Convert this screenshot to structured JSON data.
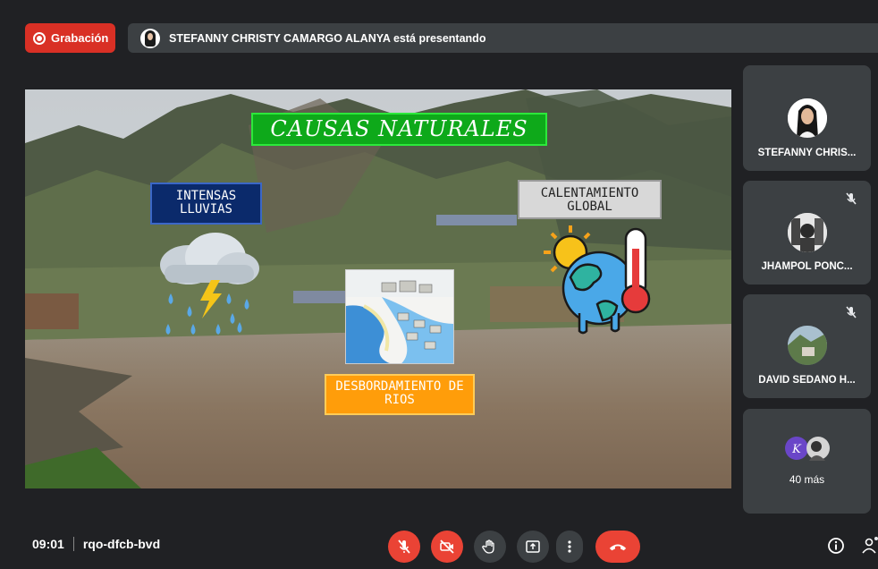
{
  "recording": {
    "label": "Grabación",
    "icon": "record-icon",
    "color": "#d93025"
  },
  "presenter_bar": {
    "text": "STEFANNY CHRISTY CAMARGO ALANYA está presentando"
  },
  "slide": {
    "title": "CAUSAS NATURALES",
    "cause_rain": "INTENSAS LLUVIAS",
    "cause_warming": "CALENTAMIENTO GLOBAL",
    "cause_overflow": "DESBORDAMIENTO DE RIOS"
  },
  "participants": [
    {
      "name": "STEFANNY CHRIS...",
      "muted": false
    },
    {
      "name": "JHAMPOL PONC...",
      "muted": true
    },
    {
      "name": "DAVID SEDANO H...",
      "muted": true
    }
  ],
  "more_tile": {
    "label": "40 más"
  },
  "meeting": {
    "time": "09:01",
    "code": "rqo-dfcb-bvd"
  },
  "controls": [
    {
      "name": "mic-off-button",
      "icon": "mic-off-icon"
    },
    {
      "name": "camera-off-button",
      "icon": "camera-off-icon"
    },
    {
      "name": "raise-hand-button",
      "icon": "hand-icon"
    },
    {
      "name": "present-button",
      "icon": "present-icon"
    },
    {
      "name": "more-options-button",
      "icon": "more-vert-icon"
    },
    {
      "name": "leave-call-button",
      "icon": "hangup-icon"
    }
  ],
  "colors": {
    "background": "#202124",
    "tile": "#3c4043",
    "danger": "#ea4335"
  }
}
